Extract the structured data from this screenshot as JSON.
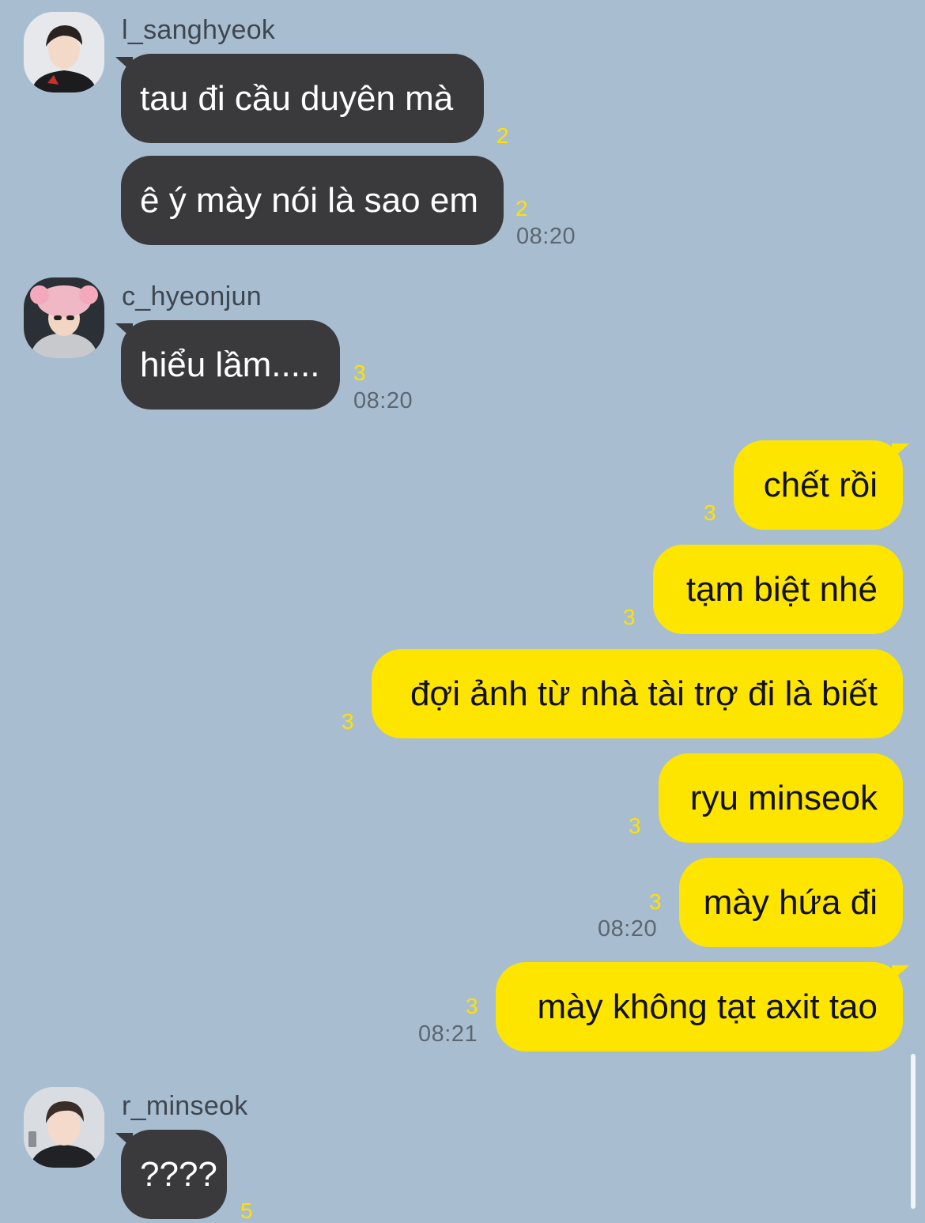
{
  "colors": {
    "background": "#a9bdd1",
    "incoming_bubble": "#3a3a3c",
    "outgoing_bubble": "#fee500",
    "unread_count": "#ffe100"
  },
  "groups": [
    {
      "sender": "l_sanghyeok",
      "messages": [
        {
          "text": "tau đi cầu duyên mà",
          "unread": "2"
        },
        {
          "text": "ê ý mày nói là sao em",
          "unread": "2",
          "time": "08:20"
        }
      ]
    },
    {
      "sender": "c_hyeonjun",
      "messages": [
        {
          "text": "hiểu lầm.....",
          "unread": "3",
          "time": "08:20"
        }
      ]
    },
    {
      "sender": "me",
      "messages": [
        {
          "text": "chết rồi",
          "unread": "3"
        },
        {
          "text": "tạm biệt nhé",
          "unread": "3"
        },
        {
          "text": "đợi ảnh từ nhà tài trợ đi là biết",
          "unread": "3"
        },
        {
          "text": "ryu minseok",
          "unread": "3"
        },
        {
          "text": "mày hứa đi",
          "unread": "3",
          "time": "08:20"
        },
        {
          "text": "mày không tạt axit tao",
          "unread": "3",
          "time": "08:21"
        }
      ]
    },
    {
      "sender": "r_minseok",
      "messages": [
        {
          "text": "????",
          "unread": "5"
        }
      ]
    }
  ]
}
